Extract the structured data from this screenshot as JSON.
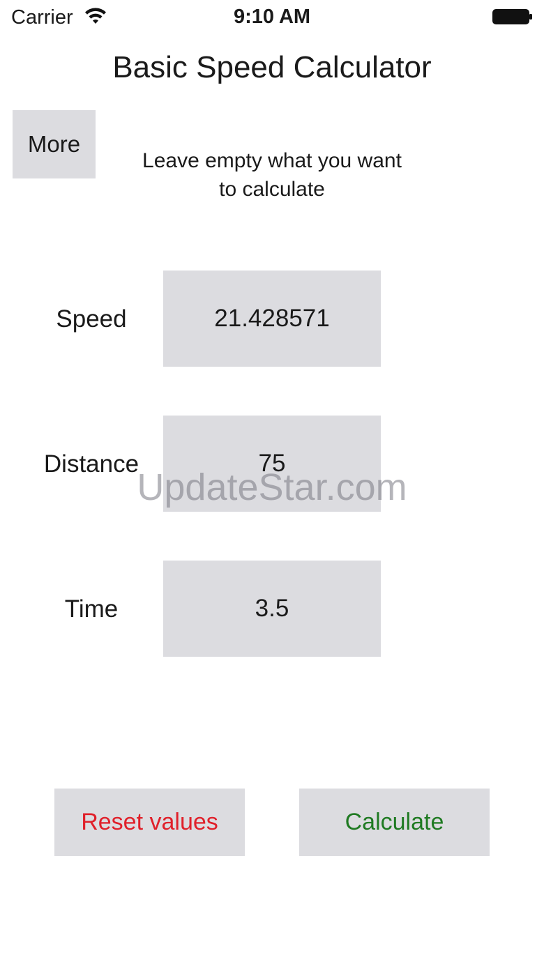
{
  "status_bar": {
    "carrier": "Carrier",
    "time": "9:10 AM",
    "wifi_icon": "wifi-icon",
    "battery_icon": "battery-icon"
  },
  "title": "Basic Speed Calculator",
  "more_label": "More",
  "instruction": "Leave empty what you want to calculate",
  "fields": {
    "speed": {
      "label": "Speed",
      "value": "21.428571"
    },
    "distance": {
      "label": "Distance",
      "value": "75"
    },
    "time": {
      "label": "Time",
      "value": "3.5"
    }
  },
  "buttons": {
    "reset": {
      "label": "Reset values",
      "color": "#e0202a"
    },
    "calculate": {
      "label": "Calculate",
      "color": "#1f7a22"
    }
  },
  "watermark": "UpdateStar.com",
  "colors": {
    "button_bg": "#dcdce0",
    "background": "#ffffff"
  }
}
